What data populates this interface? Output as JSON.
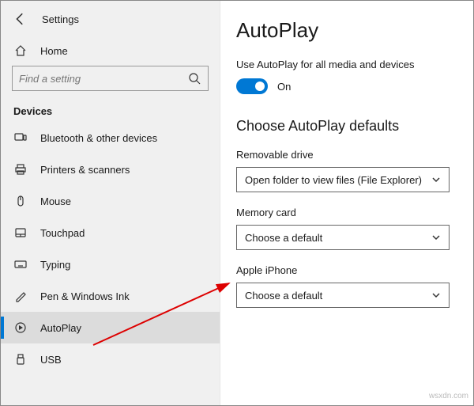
{
  "window": {
    "title": "Settings"
  },
  "sidebar": {
    "home": "Home",
    "search_placeholder": "Find a setting",
    "category": "Devices",
    "items": [
      {
        "label": "Bluetooth & other devices"
      },
      {
        "label": "Printers & scanners"
      },
      {
        "label": "Mouse"
      },
      {
        "label": "Touchpad"
      },
      {
        "label": "Typing"
      },
      {
        "label": "Pen & Windows Ink"
      },
      {
        "label": "AutoPlay"
      },
      {
        "label": "USB"
      }
    ]
  },
  "main": {
    "page_title": "AutoPlay",
    "toggle_label": "Use AutoPlay for all media and devices",
    "toggle_state": "On",
    "section_title": "Choose AutoPlay defaults",
    "fields": {
      "removable_drive": {
        "label": "Removable drive",
        "value": "Open folder to view files (File Explorer)"
      },
      "memory_card": {
        "label": "Memory card",
        "value": "Choose a default"
      },
      "apple_iphone": {
        "label": "Apple iPhone",
        "value": "Choose a default"
      }
    }
  },
  "watermark": "wsxdn.com"
}
